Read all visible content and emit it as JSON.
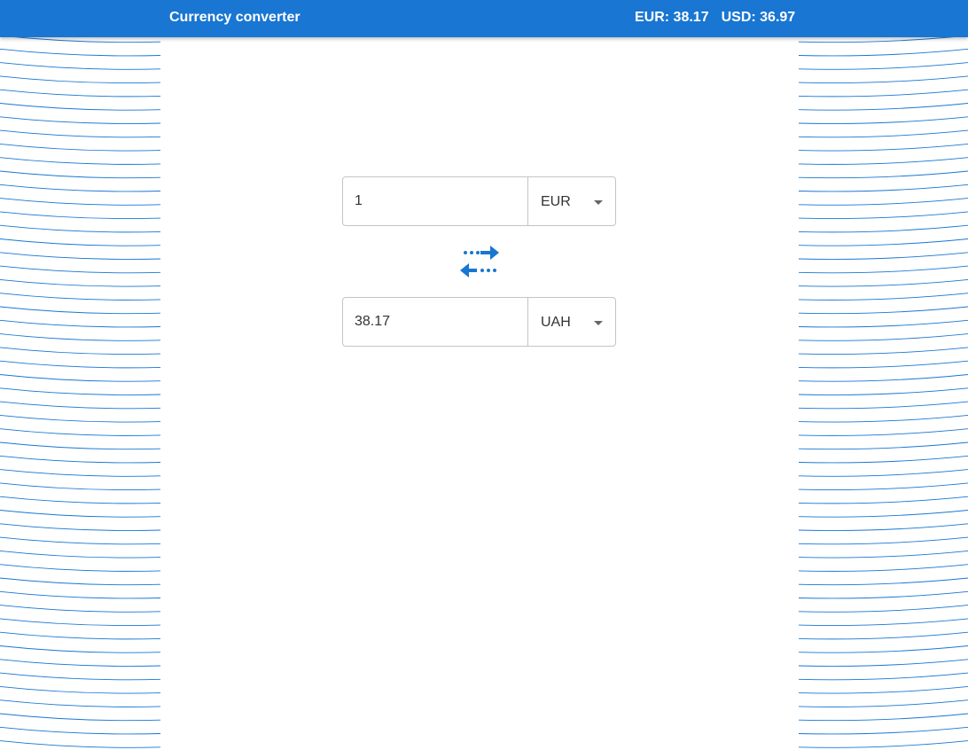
{
  "header": {
    "title": "Currency converter",
    "rates": [
      {
        "label": "EUR: 38.17"
      },
      {
        "label": "USD: 36.97"
      }
    ]
  },
  "converter": {
    "from": {
      "amount": "1",
      "currency": "EUR"
    },
    "to": {
      "amount": "38.17",
      "currency": "UAH"
    },
    "swap_icon": "swap-arrows-icon"
  },
  "colors": {
    "primary": "#1976d2",
    "pattern_line": "#1976d2",
    "field_border": "#c4c4c4"
  }
}
